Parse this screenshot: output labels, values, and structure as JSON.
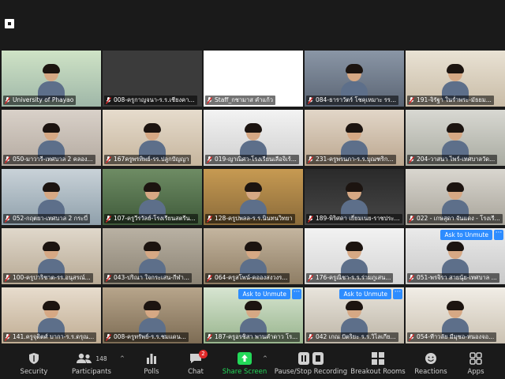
{
  "colors": {
    "accent": "#2d8cff",
    "share": "#23d959",
    "active_border": "#c7e34b",
    "mic_muted": "#e02828"
  },
  "top_icon": "stop-square-icon",
  "unmute_label": "Ask to Unmute",
  "more_label": "···",
  "participants": [
    {
      "name": "University of Phayao",
      "active": true
    },
    {
      "name": "008-ครูกาญจนา-ร.ร.เชียงคา..."
    },
    {
      "name": "Staff_กชามาส คำแก้ว"
    },
    {
      "name": "084-ธาราวัตร์ โชคุเหมาะ รร..."
    },
    {
      "name": "191-จิรัฐา ในร่ำพระ-มัธยม..."
    },
    {
      "name": "050-มาวารี-เทศบาล 2 คลอง..."
    },
    {
      "name": "167ครูพรทิพย์-รร.ปลูกปัญญา"
    },
    {
      "name": "019-ญาณิศา-โรงเรียนเลือจิเร้..."
    },
    {
      "name": "231-ครูพรนภา-ร.ร.บุณฑริก..."
    },
    {
      "name": "204-วาสนา ไพร์-เทศบาลวัด..."
    },
    {
      "name": "052-กฤตยา-เทศบาล 2 กระบี่"
    },
    {
      "name": "107-ครูวีรวัลย์-โรงเรียนสตรีน..."
    },
    {
      "name": "128-ครูปพลล-ร.ร.นินทนวิทยา"
    },
    {
      "name": "189-พิริศดา เยี่ยมเนย-ราชประ..."
    },
    {
      "name": "022 - เกษสุดา จันแดง - โรงเรี..."
    },
    {
      "name": "100-ครูปาริชาต-รร.อนุสรณ์..."
    },
    {
      "name": "043-ปริณา ใจกระเสน-กีฬา..."
    },
    {
      "name": "064-ครูสโพน์-คอองสงวงร..."
    },
    {
      "name": "176-ครูณิชา-ร.ร.ร่ามภูเสน..."
    },
    {
      "name": "051-พรจิรา สายนุ้ย-เทศบาล ...",
      "unmute": true
    },
    {
      "name": "141.ครูจุติตศ์ บากา-ร.ร.ดรุณ..."
    },
    {
      "name": "008-ครูทรัพย์-ร.ร.ชมแดน..."
    },
    {
      "name": "187-ครูอรชิสา พานคำดาว โร...",
      "unmute": true
    },
    {
      "name": "042 เกณ ปัตริยะ ร.ร.วิไลเกีย...",
      "unmute": true
    },
    {
      "name": "054-ทีาวลัย มีมุซอ-หนองจอ..."
    }
  ],
  "toolbar": {
    "security": {
      "label": "Security",
      "icon": "shield-icon"
    },
    "participants": {
      "label": "Participants",
      "icon": "people-icon",
      "count": "148"
    },
    "polls": {
      "label": "Polls",
      "icon": "poll-icon"
    },
    "chat": {
      "label": "Chat",
      "icon": "chat-icon",
      "badge": "2"
    },
    "share": {
      "label": "Share Screen",
      "icon": "share-screen-icon"
    },
    "record": {
      "label": "Pause/Stop Recording",
      "icon": "pause-stop-icon"
    },
    "breakout": {
      "label": "Breakout Rooms",
      "icon": "breakout-rooms-icon"
    },
    "reactions": {
      "label": "Reactions",
      "icon": "smiley-icon"
    },
    "apps": {
      "label": "Apps",
      "icon": "apps-icon"
    }
  }
}
